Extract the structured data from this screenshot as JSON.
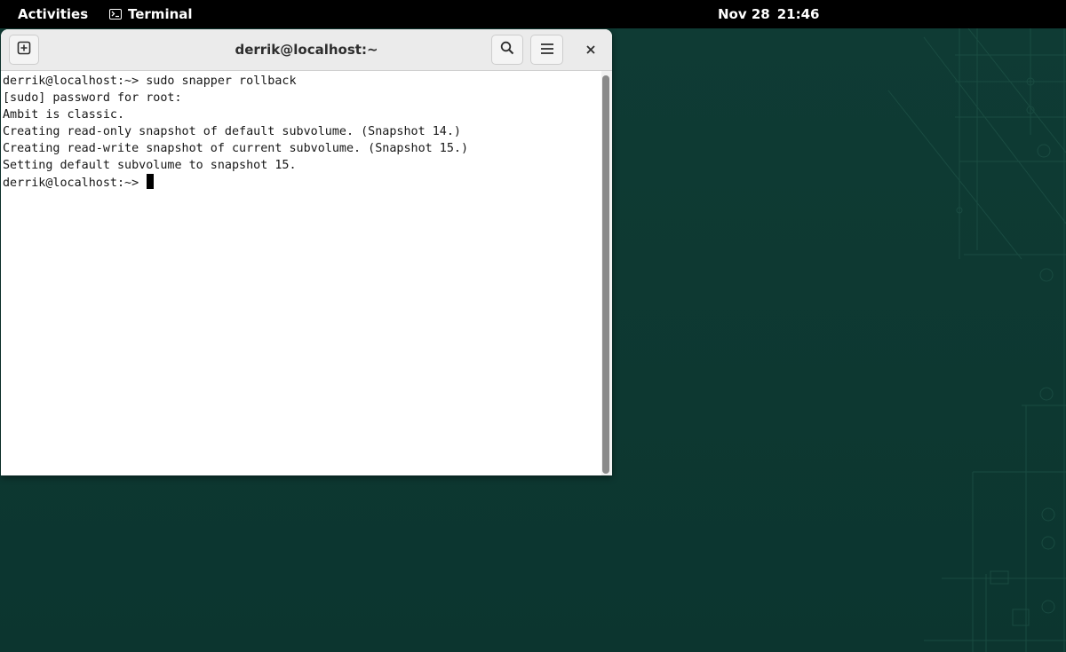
{
  "topbar": {
    "activities_label": "Activities",
    "app_label": "Terminal",
    "clock_date": "Nov 28",
    "clock_time": "21:46",
    "app_icon": "terminal-icon"
  },
  "window": {
    "title": "derrik@localhost:~",
    "buttons": {
      "new_tab_icon": "new-tab-icon",
      "search_icon": "search-icon",
      "menu_icon": "hamburger-menu-icon",
      "close_icon": "close-icon"
    }
  },
  "terminal": {
    "lines": [
      "derrik@localhost:~> sudo snapper rollback",
      "[sudo] password for root:",
      "Ambit is classic.",
      "Creating read-only snapshot of default subvolume. (Snapshot 14.)",
      "Creating read-write snapshot of current subvolume. (Snapshot 15.)",
      "Setting default subvolume to snapshot 15."
    ],
    "prompt": "derrik@localhost:~> "
  },
  "colors": {
    "desktop_background": "#0e3a33",
    "topbar_background": "#000000",
    "terminal_background": "#ffffff",
    "terminal_text": "#171717"
  }
}
